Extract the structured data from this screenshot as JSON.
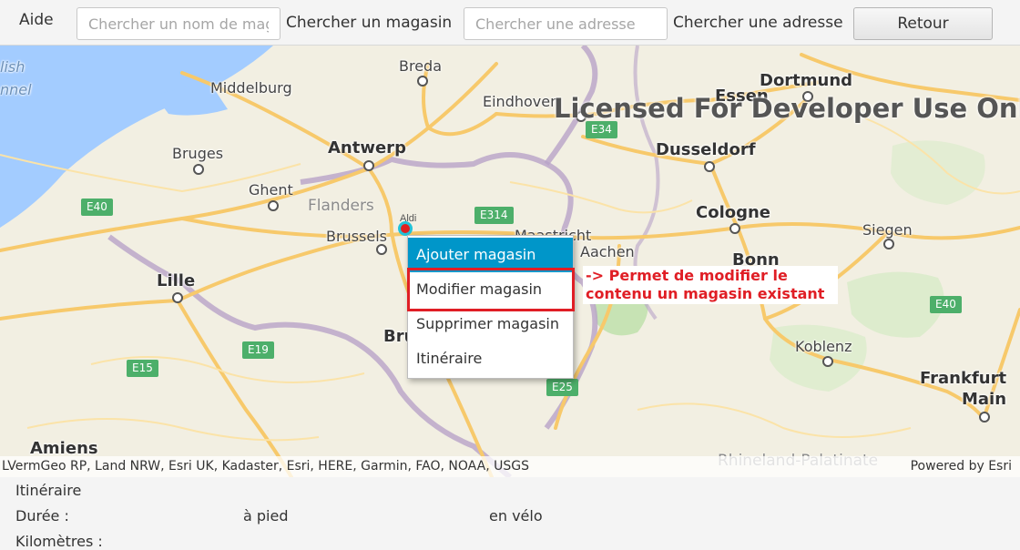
{
  "toolbar": {
    "help_label": "Aide",
    "store_search_placeholder": "Chercher un nom de magasin",
    "store_search_label": "Chercher un magasin",
    "address_search_placeholder": "Chercher une adresse",
    "address_search_label": "Chercher une adresse",
    "back_label": "Retour"
  },
  "map": {
    "watermark": "Licensed For Developer Use Only",
    "attribution": "LVermGeo RP, Land NRW, Esri UK, Kadaster, Esri, HERE, Garmin, FAO, NOAA, USGS",
    "powered_by": "Powered by Esri",
    "pin_label": "Aldi",
    "region_labels": [
      "Flanders",
      "Rhineland-Palatinate"
    ],
    "cities": [
      "Breda",
      "Dortmund",
      "Middelburg",
      "Essen",
      "Eindhoven",
      "Antwerp",
      "Dusseldorf",
      "Bruges",
      "Ghent",
      "Cologne",
      "Brussels",
      "Siegen",
      "Aachen",
      "Bonn",
      "Lille",
      "Koblenz",
      "Frankfurt",
      "Main",
      "Amiens",
      "lish",
      "nnel",
      "Maastricht",
      "Bru"
    ],
    "road_shields": [
      "E34",
      "E40",
      "E314",
      "E19",
      "E15",
      "E25",
      "E40"
    ],
    "colors": {
      "water": "#a3ccff",
      "land": "#f2efe2",
      "roads": "#f7c96b",
      "forest": "#c7e3b4",
      "pin": "#e02020"
    }
  },
  "context_menu": {
    "items": [
      "Ajouter magasin",
      "Modifier magasin",
      "Supprimer magasin",
      "Itinéraire"
    ],
    "active_index": 0
  },
  "annotation": {
    "line1": "-> Permet de modifier le",
    "line2": "contenu un magasin existant",
    "color": "#e01e25"
  },
  "bottom_panel": {
    "itinerary_label": "Itinéraire",
    "duration_label": "Durée :",
    "walking_label": "à pied",
    "cycling_label": "en vélo",
    "kilometers_label": "Kilomètres :"
  }
}
